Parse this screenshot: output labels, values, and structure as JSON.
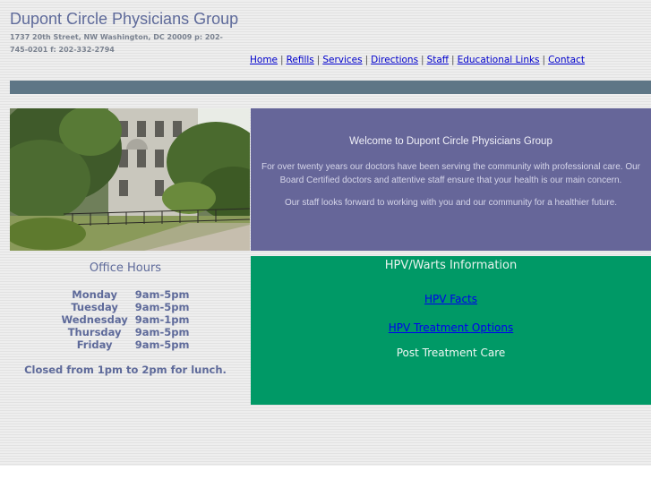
{
  "site": {
    "title": "Dupont Circle Physicians Group",
    "address": "1737 20th Street, NW  Washington, DC 20009  p: 202-745-0201   f: 202-332-2794"
  },
  "nav": [
    {
      "label": "Home"
    },
    {
      "label": "Refills"
    },
    {
      "label": "Services"
    },
    {
      "label": "Directions"
    },
    {
      "label": "Staff"
    },
    {
      "label": "Educational Links"
    },
    {
      "label": "Contact"
    }
  ],
  "nav_separator": "|",
  "welcome": {
    "title": "Welcome to Dupont Circle Physicians Group",
    "body": "For over twenty years our doctors have been serving the community with professional care. Our Board Certified doctors and attentive staff ensure that your health is our main concern.",
    "closing": "Our staff looks forward to working with you and our community for a healthier future."
  },
  "office_hours": {
    "title": "Office Hours",
    "rows": [
      {
        "day": "Monday",
        "hours": "9am-5pm"
      },
      {
        "day": "Tuesday",
        "hours": "9am-5pm"
      },
      {
        "day": "Wednesday",
        "hours": "9am-1pm"
      },
      {
        "day": "Thursday",
        "hours": "9am-5pm"
      },
      {
        "day": "Friday",
        "hours": "9am-5pm"
      }
    ],
    "note": "Closed from 1pm to 2pm for lunch."
  },
  "hpv": {
    "title": "HPV/Warts Information",
    "link1": "HPV Facts",
    "link2": "HPV Treatment Options",
    "text": "Post Treatment Care"
  },
  "colors": {
    "title_blue": "#5e6a9a",
    "band": "#5e7686",
    "welcome_bg": "#666699",
    "hpv_bg": "#009966",
    "link": "#0000cc"
  }
}
